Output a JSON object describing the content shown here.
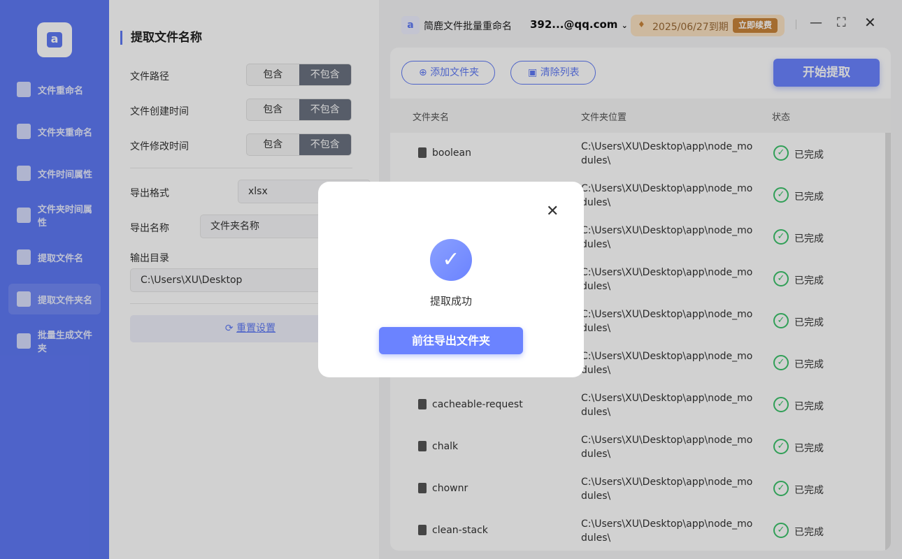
{
  "sidebar": {
    "items": [
      {
        "label": "文件重命名"
      },
      {
        "label": "文件夹重命名"
      },
      {
        "label": "文件时间属性"
      },
      {
        "label": "文件夹时间属性"
      },
      {
        "label": "提取文件名"
      },
      {
        "label": "提取文件夹名",
        "active": true
      },
      {
        "label": "批量生成文件夹"
      }
    ]
  },
  "panel": {
    "title": "提取文件名称",
    "options": [
      {
        "label": "文件路径",
        "a": "包含",
        "b": "不包含",
        "selected": "不包含"
      },
      {
        "label": "文件创建时间",
        "a": "包含",
        "b": "不包含",
        "selected": "不包含"
      },
      {
        "label": "文件修改时间",
        "a": "包含",
        "b": "不包含",
        "selected": "不包含"
      }
    ],
    "export_format_label": "导出格式",
    "export_format": "xlsx",
    "export_name_label": "导出名称",
    "export_name": "文件夹名称",
    "output_dir_label": "输出目录",
    "output_dir": "C:\\Users\\XU\\Desktop",
    "reset_label": "重置设置"
  },
  "topbar": {
    "app_name": "简鹿文件批量重命名",
    "account": "392...@qq.com",
    "expiry": "2025/06/27到期",
    "renew": "立即续费"
  },
  "toolbar": {
    "add_folder": "添加文件夹",
    "clear_list": "清除列表",
    "start": "开始提取"
  },
  "table": {
    "headers": [
      "文件夹名",
      "文件夹位置",
      "状态"
    ],
    "rows": [
      {
        "name": "boolean",
        "location": "C:\\Users\\XU\\Desktop\\app\\node_modules\\",
        "status": "已完成"
      },
      {
        "name": "",
        "location": "C:\\Users\\XU\\Desktop\\app\\node_modules\\",
        "status": "已完成"
      },
      {
        "name": "",
        "location": "C:\\Users\\XU\\Desktop\\app\\node_modules\\",
        "status": "已完成"
      },
      {
        "name": "",
        "location": "C:\\Users\\XU\\Desktop\\app\\node_modules\\",
        "status": "已完成"
      },
      {
        "name": "",
        "location": "C:\\Users\\XU\\Desktop\\app\\node_modules\\",
        "status": "已完成"
      },
      {
        "name": "",
        "location": "C:\\Users\\XU\\Desktop\\app\\node_modules\\",
        "status": "已完成"
      },
      {
        "name": "cacheable-request",
        "location": "C:\\Users\\XU\\Desktop\\app\\node_modules\\",
        "status": "已完成"
      },
      {
        "name": "chalk",
        "location": "C:\\Users\\XU\\Desktop\\app\\node_modules\\",
        "status": "已完成"
      },
      {
        "name": "chownr",
        "location": "C:\\Users\\XU\\Desktop\\app\\node_modules\\",
        "status": "已完成"
      },
      {
        "name": "clean-stack",
        "location": "C:\\Users\\XU\\Desktop\\app\\node_modules\\",
        "status": "已完成"
      }
    ]
  },
  "modal": {
    "message": "提取成功",
    "button": "前往导出文件夹"
  },
  "colors": {
    "accent": "#5f79f5",
    "success": "#3cc36b",
    "vip": "#c8843a"
  }
}
